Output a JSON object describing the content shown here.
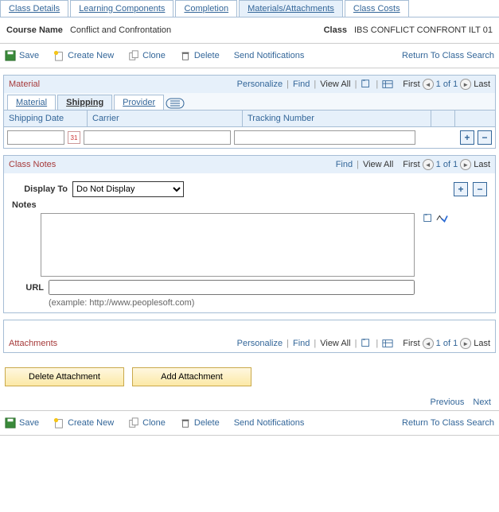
{
  "tabs": {
    "details": "Class Details",
    "learning": "Learning Components",
    "completion": "Completion",
    "materials": "Materials/Attachments",
    "costs": "Class Costs"
  },
  "header": {
    "course_label": "Course Name",
    "course_value": "Conflict and Confrontation",
    "class_label": "Class",
    "class_value": "IBS CONFLICT CONFRONT ILT 01"
  },
  "toolbar": {
    "save": "Save",
    "create_new": "Create New",
    "clone": "Clone",
    "delete": "Delete",
    "send_notifications": "Send Notifications",
    "return": "Return To Class Search"
  },
  "material": {
    "title": "Material",
    "personalize": "Personalize",
    "find": "Find",
    "view_all": "View All",
    "first": "First",
    "count": "1 of 1",
    "last": "Last",
    "subtabs": {
      "material": "Material",
      "shipping": "Shipping",
      "provider": "Provider"
    },
    "cols": {
      "shipping_date": "Shipping Date",
      "carrier": "Carrier",
      "tracking": "Tracking Number"
    },
    "row": {
      "shipping_date": "",
      "carrier": "",
      "tracking": ""
    }
  },
  "class_notes": {
    "title": "Class Notes",
    "find": "Find",
    "view_all": "View All",
    "first": "First",
    "count": "1 of 1",
    "last": "Last",
    "display_to_label": "Display To",
    "display_to_value": "Do Not Display",
    "notes_label": "Notes",
    "notes_value": "",
    "url_label": "URL",
    "url_value": "",
    "url_hint": "(example: http://www.peoplesoft.com)"
  },
  "attachments": {
    "title": "Attachments",
    "personalize": "Personalize",
    "find": "Find",
    "view_all": "View All",
    "first": "First",
    "count": "1 of 1",
    "last": "Last",
    "delete_btn": "Delete Attachment",
    "add_btn": "Add Attachment"
  },
  "footer_nav": {
    "previous": "Previous",
    "next": "Next"
  }
}
